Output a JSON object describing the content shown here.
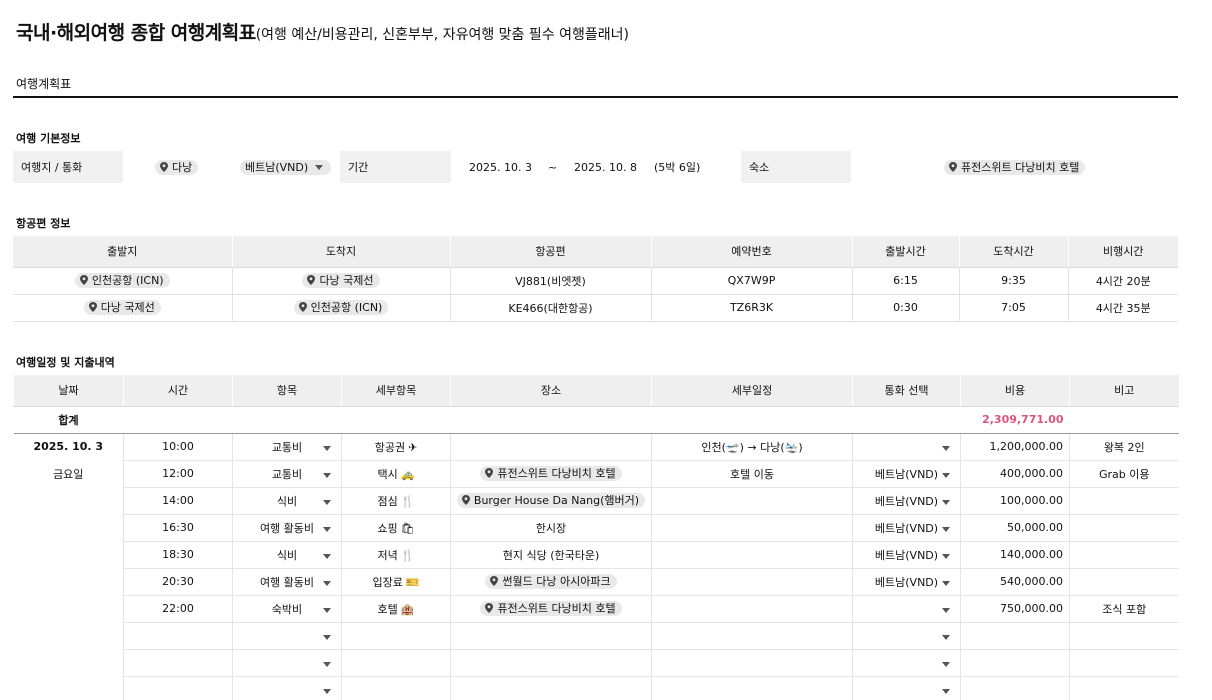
{
  "title": {
    "main": "국내·해외여행 종합 여행계획표",
    "sub": "(여행 예산/비용관리, 신혼부부, 자유여행 맞춤 필수 여행플래너)"
  },
  "sheet_tab": "여행계획표",
  "basic": {
    "section_title": "여행 기본정보",
    "dest_label": "여행지 / 통화",
    "dest_value": "다낭",
    "currency": "베트남(VND)",
    "period_label": "기간",
    "start_date": "2025. 10. 3",
    "tilde": "~",
    "end_date": "2025. 10. 8",
    "duration": "(5박 6일)",
    "lodging_label": "숙소",
    "lodging_value": "퓨전스위트 다낭비치 호텔"
  },
  "flights": {
    "section_title": "항공편 정보",
    "headers": [
      "출발지",
      "도착지",
      "항공편",
      "예약번호",
      "출발시간",
      "도착시간",
      "비행시간"
    ],
    "rows": [
      {
        "from": "인천공항 (ICN)",
        "to": "다낭 국제선",
        "flight": "VJ881(비엣젯)",
        "booking": "QX7W9P",
        "dep": "6:15",
        "arr": "9:35",
        "dur": "4시간 20분"
      },
      {
        "from": "다낭 국제선",
        "to": "인천공항 (ICN)",
        "flight": "KE466(대한항공)",
        "booking": "TZ6R3K",
        "dep": "0:30",
        "arr": "7:05",
        "dur": "4시간 35분"
      }
    ]
  },
  "itinerary": {
    "section_title": "여행일정 및 지출내역",
    "headers": [
      "날짜",
      "시간",
      "항목",
      "세부항목",
      "장소",
      "세부일정",
      "통화 선택",
      "비용",
      "비고"
    ],
    "total_label": "합계",
    "total_value": "2,309,771.00",
    "date": "2025. 10. 3",
    "weekday": "금요일",
    "rows": [
      {
        "time": "10:00",
        "category": "교통비",
        "sub": "항공권",
        "icon": "✈",
        "place": "",
        "detail": "인천(🛫) → 다낭(🛬)",
        "currency": "",
        "cost": "1,200,000.00",
        "note": "왕복 2인"
      },
      {
        "time": "12:00",
        "category": "교통비",
        "sub": "택시",
        "icon": "🚕",
        "place": "퓨전스위트 다낭비치 호텔",
        "detail": "호텔 이동",
        "currency": "베트남(VND)",
        "cost": "400,000.00",
        "note": "Grab 이용"
      },
      {
        "time": "14:00",
        "category": "식비",
        "sub": "점심",
        "icon": "🍴",
        "place": "Burger House Da Nang(햄버거)",
        "detail": "",
        "currency": "베트남(VND)",
        "cost": "100,000.00",
        "note": ""
      },
      {
        "time": "16:30",
        "category": "여행 활동비",
        "sub": "쇼핑",
        "icon": "🛍",
        "place_text": "한시장",
        "detail": "",
        "currency": "베트남(VND)",
        "cost": "50,000.00",
        "note": ""
      },
      {
        "time": "18:30",
        "category": "식비",
        "sub": "저녁",
        "icon": "🍴",
        "place_text": "현지 식당 (한국타운)",
        "detail": "",
        "currency": "베트남(VND)",
        "cost": "140,000.00",
        "note": ""
      },
      {
        "time": "20:30",
        "category": "여행 활동비",
        "sub": "입장료",
        "icon": "🎫",
        "place": "썬월드 다낭 아시아파크",
        "detail": "",
        "currency": "베트남(VND)",
        "cost": "540,000.00",
        "note": ""
      },
      {
        "time": "22:00",
        "category": "숙박비",
        "sub": "호텔",
        "icon": "🏨",
        "place": "퓨전스위트 다낭비치 호텔",
        "detail": "",
        "currency": "",
        "cost": "750,000.00",
        "note": "조식 포함"
      }
    ]
  },
  "icons": {
    "pin": "map-pin-icon",
    "dropdown": "chevron-down-icon"
  }
}
